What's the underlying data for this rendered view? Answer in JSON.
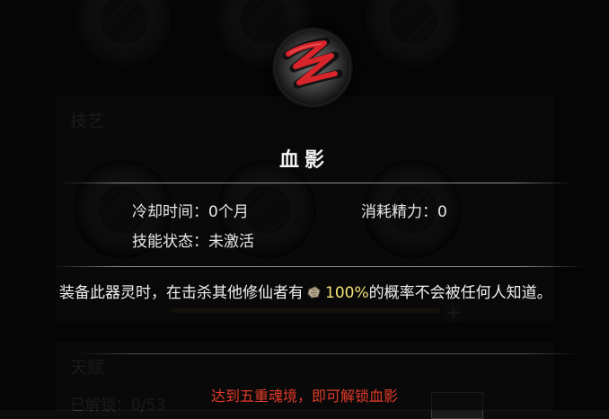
{
  "skill": {
    "icon": "red-slash-rune-icon",
    "name": "血影",
    "cooldown_label": "冷却时间：",
    "cooldown_value": "0个月",
    "cost_label": "消耗精力：",
    "cost_value": "0",
    "state_label": "技能状态：",
    "state_value": "未激活"
  },
  "description": {
    "prefix": "装备此器灵时，在击杀其他修仙者有",
    "item_icon": "talisman-icon",
    "chance": "100%",
    "suffix": "的概率不会被任何人知道。"
  },
  "unlock_hint": "达到五重魂境，即可解锁血影",
  "background": {
    "section_skills": "技艺",
    "section_talent": "天赋",
    "unlocked_text": "已解锁：0/53"
  },
  "colors": {
    "highlight": "#f1e27a",
    "warning": "#e23a2a"
  }
}
